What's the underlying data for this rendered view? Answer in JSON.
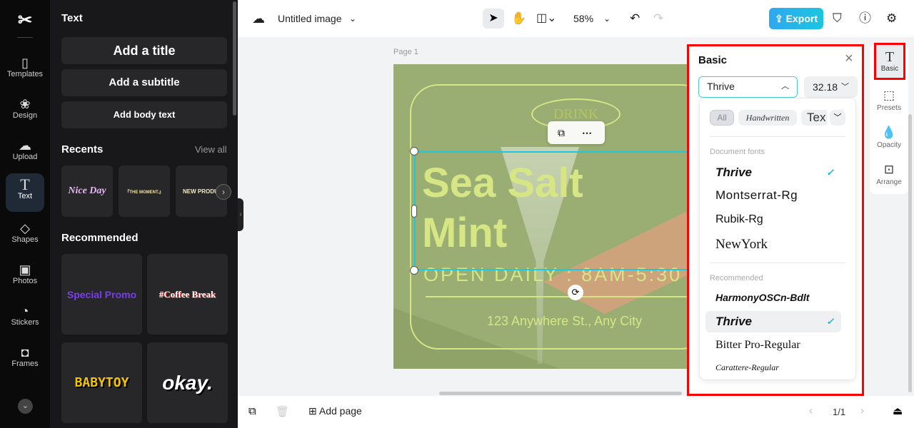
{
  "rail": {
    "items": [
      {
        "label": "Templates",
        "icon": "templates-icon"
      },
      {
        "label": "Design",
        "icon": "design-icon"
      },
      {
        "label": "Upload",
        "icon": "upload-icon"
      },
      {
        "label": "Text",
        "icon": "text-icon"
      },
      {
        "label": "Shapes",
        "icon": "shapes-icon"
      },
      {
        "label": "Photos",
        "icon": "photos-icon"
      },
      {
        "label": "Stickers",
        "icon": "stickers-icon"
      },
      {
        "label": "Frames",
        "icon": "frames-icon"
      }
    ],
    "active": "Text"
  },
  "panel": {
    "title": "Text",
    "add_title": "Add a title",
    "add_subtitle": "Add a subtitle",
    "add_body": "Add body text",
    "recents": "Recents",
    "view_all": "View all",
    "recent_items": [
      "Nice Day",
      "『THE MOMENT.』",
      "NEW PRODUCT"
    ],
    "recommended": "Recommended",
    "recommended_items": [
      "Special Promo",
      "#Coffee Break",
      "BABYTOY",
      "okay."
    ]
  },
  "topbar": {
    "doc_title": "Untitled image",
    "zoom": "58%",
    "export": "Export"
  },
  "canvas": {
    "page_label": "Page 1",
    "drink": "DRINK",
    "headline1": "Sea Salt",
    "headline2": "Mint",
    "hours": "OPEN DAILY : 8AM-5:30",
    "address": "123 Anywhere St., Any City",
    "colors": {
      "background": "#9aae74",
      "text": "#d6e684",
      "selection": "#1ec8e0"
    }
  },
  "basic": {
    "title": "Basic",
    "font": "Thrive",
    "size": "32.18",
    "filters": [
      "All",
      "Handwritten",
      "Tex"
    ],
    "document_fonts_label": "Document fonts",
    "document_fonts": [
      "Thrive",
      "Montserrat-Rg",
      "Rubik-Rg",
      "NewYork"
    ],
    "recommended_label": "Recommended",
    "recommended_fonts": [
      "HarmonyOSCn-Bdlt",
      "Thrive",
      "Bitter Pro-Regular",
      "Carattere-Regular"
    ],
    "selected": "Thrive"
  },
  "rightrail": [
    "Basic",
    "Presets",
    "Opacity",
    "Arrange"
  ],
  "bottom": {
    "add_page": "Add page",
    "page_indicator": "1/1"
  }
}
